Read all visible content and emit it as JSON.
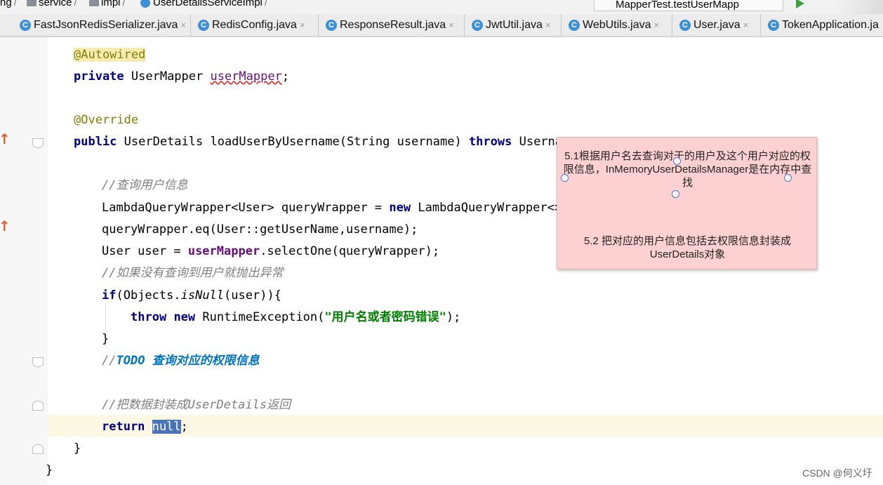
{
  "breadcrumb": {
    "items": [
      "ng",
      "service",
      "impl",
      "UserDetailsServiceImpl"
    ]
  },
  "run_config": {
    "label": "MapperTest.testUserMapp"
  },
  "tabs": [
    {
      "label": "FastJsonRedisSerializer.java",
      "icon": "C"
    },
    {
      "label": "RedisConfig.java",
      "icon": "C"
    },
    {
      "label": "ResponseResult.java",
      "icon": "C"
    },
    {
      "label": "JwtUtil.java",
      "icon": "C"
    },
    {
      "label": "WebUtils.java",
      "icon": "C"
    },
    {
      "label": "User.java",
      "icon": "C"
    },
    {
      "label": "TokenApplication.ja",
      "icon": "C"
    }
  ],
  "tab_close": "×",
  "code": {
    "autowired": "@Autowired",
    "private": "private",
    "user_mapper_type": " UserMapper ",
    "user_mapper_field": "userMapper",
    "semicolon": ";",
    "override": "@Override",
    "public": "public",
    "method_sig": " UserDetails loadUserByUsername(String username) ",
    "throws": "throws",
    "throws_rest": " Userna",
    "comment_query_user": "//查询用户信息",
    "wrapper_decl": "LambdaQueryWrapper<User> queryWrapper = ",
    "new": "new",
    "wrapper_ctor": " LambdaQueryWrapper<>(",
    "wrapper_eq": "queryWrapper.eq(User::getUserName,username);",
    "user_decl": "User user = ",
    "select_one": ".selectOne(queryWrapper);",
    "comment_not_found": "//如果没有查询到用户就抛出异常",
    "if": "if",
    "objects": "(Objects.",
    "is_null": "isNull",
    "if_rest": "(user)){",
    "throw": "throw",
    "runtime_exc": " RuntimeException(",
    "err_msg": "\"用户名或者密码错误\"",
    "close_paren": ");",
    "close_brace": "}",
    "todo_prefix": "//",
    "todo_text": "TODO 查询对应的权限信息",
    "comment_wrap": "//把数据封装成UserDetails返回",
    "return": "return",
    "null_value": "null",
    "method_close": "}",
    "class_close": "}"
  },
  "callout": {
    "para1": "5.1根据用户名去查询对于的用户及这个用户对应的权限信息，InMemoryUserDetailsManager是在内存中查找",
    "para2": "5.2 把对应的用户信息包括去权限信息封装成UserDetails对象"
  },
  "watermark": "CSDN @何义圩",
  "colors": {
    "keyword": "#000080",
    "annotation": "#808000",
    "field": "#660e7a",
    "comment": "#808080",
    "todo": "#0073bf",
    "string": "#008000",
    "callout_bg": "#fdd1d1",
    "selection": "#4a74b8"
  }
}
